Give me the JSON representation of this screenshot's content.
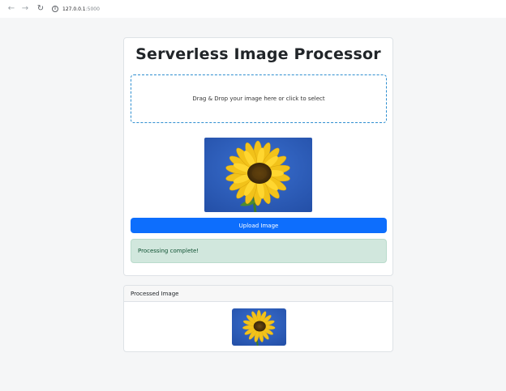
{
  "browser": {
    "url_host": "127.0.0.1",
    "url_port": ":5000"
  },
  "main": {
    "title": "Serverless Image Processor",
    "dropzone_text": "Drag & Drop your image here or click to select",
    "upload_label": "Upload Image",
    "status_text": "Processing complete!"
  },
  "processed": {
    "header": "Processed Image"
  },
  "colors": {
    "primary": "#0d6efd",
    "success_bg": "#d1e7dd",
    "dropzone_border": "#2f8fd0"
  }
}
